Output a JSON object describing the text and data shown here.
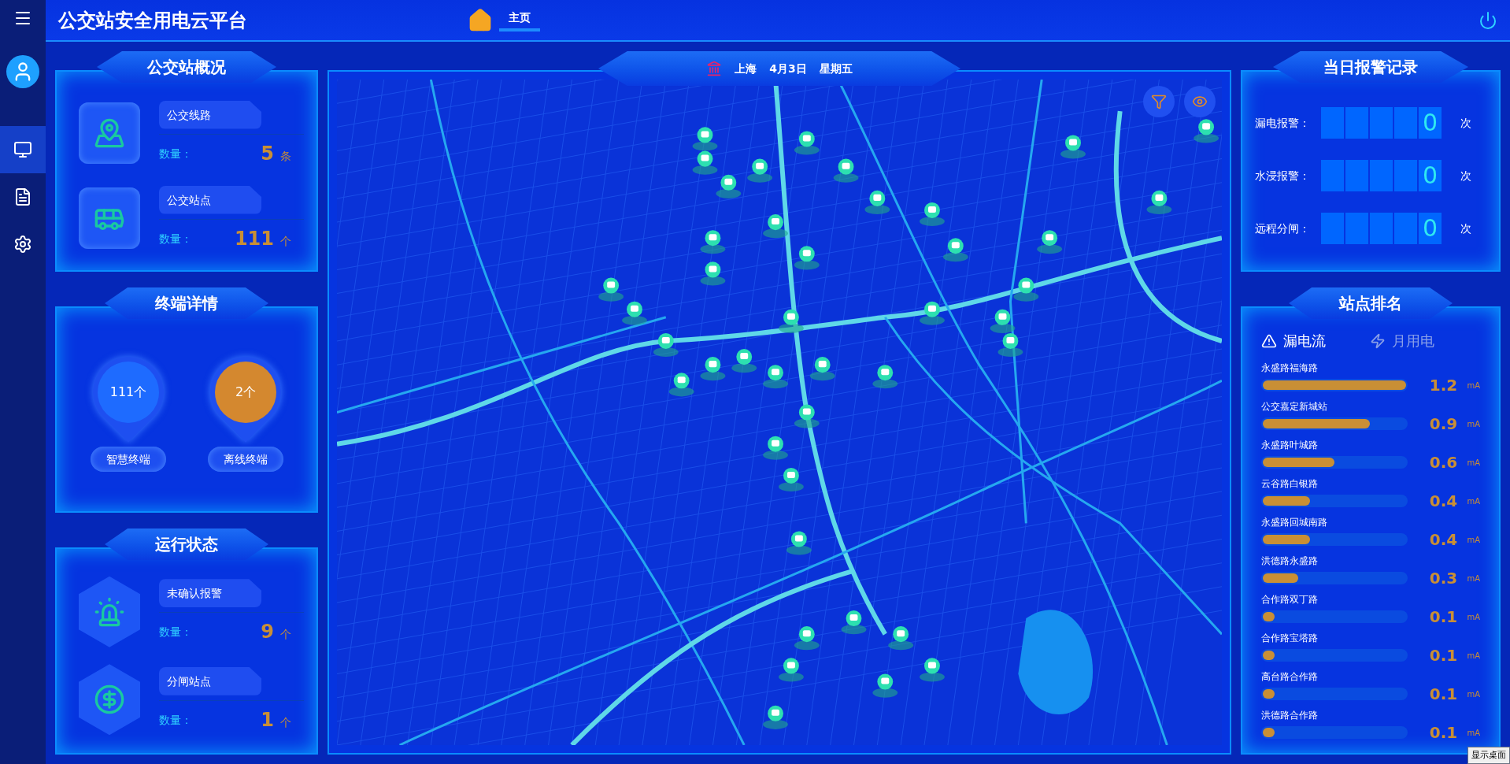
{
  "header": {
    "title": "公交站安全用电云平台",
    "nav": [
      {
        "label": "主页",
        "selected": true
      }
    ]
  },
  "sidebar": {
    "items": [
      {
        "kind": "monitor",
        "selected": true
      },
      {
        "kind": "list",
        "selected": false
      },
      {
        "kind": "settings",
        "selected": false
      }
    ]
  },
  "overview": {
    "title": "公交站概况",
    "items": [
      {
        "kind": "route",
        "label": "公交线路",
        "count_label": "数量：",
        "value": "5",
        "unit": "条"
      },
      {
        "kind": "bus",
        "label": "公交站点",
        "count_label": "数量：",
        "value": "111",
        "unit": "个"
      }
    ]
  },
  "terminals": {
    "title": "终端详情",
    "items": [
      {
        "value": "111个",
        "label": "智慧终端",
        "color": "#1e6bff"
      },
      {
        "value": "2个",
        "label": "离线终端",
        "color": "#d4882f"
      }
    ]
  },
  "status": {
    "title": "运行状态",
    "items": [
      {
        "kind": "alarm",
        "label": "未确认报警",
        "count_label": "数量：",
        "value": "9",
        "unit": "个"
      },
      {
        "kind": "switch",
        "label": "分闸站点",
        "count_label": "数量：",
        "value": "1",
        "unit": "个"
      }
    ]
  },
  "map": {
    "location": "上海",
    "date": "4月3日",
    "weekday": "星期五"
  },
  "alarms": {
    "title": "当日报警记录",
    "rows": [
      {
        "label": "漏电报警：",
        "value": "0",
        "unit": "次"
      },
      {
        "label": "水浸报警：",
        "value": "0",
        "unit": "次"
      },
      {
        "label": "远程分闸：",
        "value": "0",
        "unit": "次"
      }
    ]
  },
  "ranking": {
    "title": "站点排名",
    "tabs": [
      {
        "kind": "warning",
        "label": "漏电流",
        "selected": true
      },
      {
        "kind": "bolt",
        "label": "月用电",
        "selected": false
      }
    ],
    "rows": [
      {
        "name": "永盛路福海路",
        "value": "1.2",
        "unit": "mA",
        "level": 1
      },
      {
        "name": "公交嘉定新城站",
        "value": "0.9",
        "unit": "mA",
        "level": 0.75
      },
      {
        "name": "永盛路叶城路",
        "value": "0.6",
        "unit": "mA",
        "level": 0.5
      },
      {
        "name": "云谷路白银路",
        "value": "0.4",
        "unit": "mA",
        "level": 0.33
      },
      {
        "name": "永盛路回城南路",
        "value": "0.4",
        "unit": "mA",
        "level": 0.33
      },
      {
        "name": "洪德路永盛路",
        "value": "0.3",
        "unit": "mA",
        "level": 0.25
      },
      {
        "name": "合作路双丁路",
        "value": "0.1",
        "unit": "mA",
        "level": 0.08
      },
      {
        "name": "合作路宝塔路",
        "value": "0.1",
        "unit": "mA",
        "level": 0.08
      },
      {
        "name": "高台路合作路",
        "value": "0.1",
        "unit": "mA",
        "level": 0.08
      },
      {
        "name": "洪德路合作路",
        "value": "0.1",
        "unit": "mA",
        "level": 0.08
      }
    ]
  },
  "tooltip": "显示桌面"
}
